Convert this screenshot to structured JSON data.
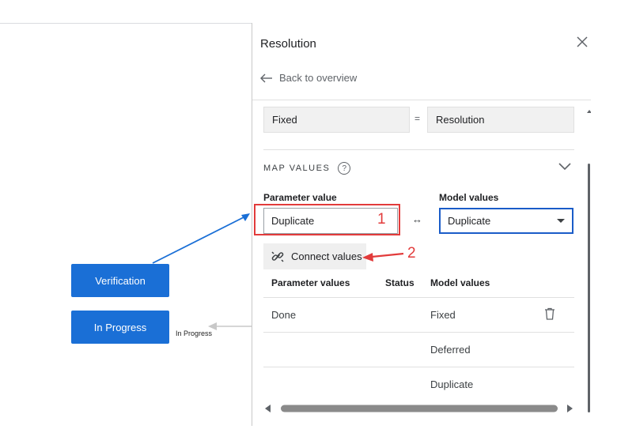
{
  "canvas": {
    "nodes": [
      {
        "label": "Verification"
      },
      {
        "label": "In Progress"
      }
    ],
    "edge_label": "In Progress",
    "colors": {
      "node": "#1a6fd6",
      "edge": "#1a6fd6"
    }
  },
  "panel": {
    "title": "Resolution",
    "back_label": "Back to overview",
    "mapping": {
      "left": "Fixed",
      "operator": "=",
      "right": "Resolution"
    },
    "map_values": {
      "title": "MAP VALUES",
      "help_glyph": "?",
      "parameter_label": "Parameter value",
      "parameter_value": "Duplicate",
      "swap_glyph": "↔",
      "model_label": "Model values",
      "model_selected": "Duplicate",
      "connect_label": "Connect values"
    },
    "table": {
      "headers": [
        "Parameter values",
        "Status",
        "Model values"
      ],
      "rows": [
        {
          "parameter": "Done",
          "status": "",
          "model": "Fixed"
        },
        {
          "parameter": "",
          "status": "",
          "model": "Deferred"
        },
        {
          "parameter": "",
          "status": "",
          "model": "Duplicate"
        }
      ]
    }
  },
  "annotations": {
    "step1": "1",
    "step2": "2",
    "color": "#e23b3b"
  }
}
